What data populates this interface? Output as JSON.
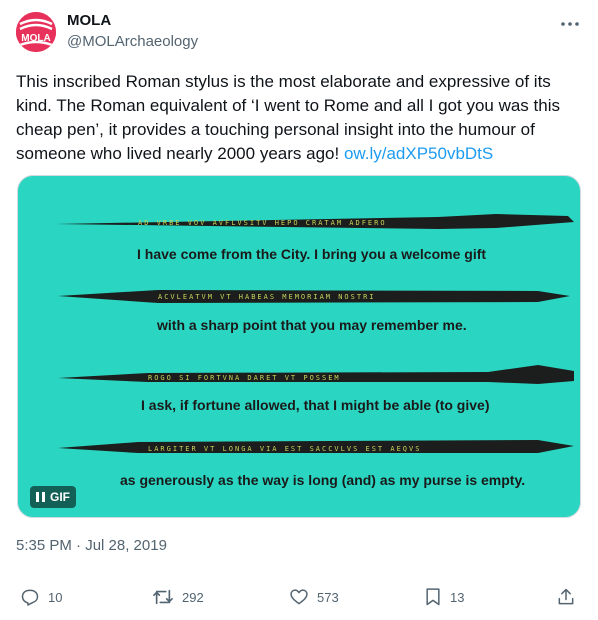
{
  "author": {
    "name": "MOLA",
    "handle": "@MOLArchaeology",
    "avatar_text": "MOLA"
  },
  "tweet": {
    "text_part1": "This inscribed Roman stylus is the most elaborate and expressive of its kind. The Roman equivalent of ‘I went to Rome and all I got you was this cheap pen’, it provides a touching personal insight into the humour of someone who lived nearly 2000 years ago! ",
    "link": "ow.ly/adXP50vbDtS"
  },
  "media": {
    "captions": [
      "I have come from the City. I bring you a welcome gift",
      "with a sharp point that you may remember me.",
      "I ask, if fortune allowed, that I might be able (to give)",
      "as generously as the way is long (and) as my purse is empty."
    ],
    "gif_label": "GIF",
    "background_color": "#2ad6c2"
  },
  "timestamp": "5:35 PM · Jul 28, 2019",
  "actions": {
    "replies": "10",
    "retweets": "292",
    "likes": "573",
    "bookmarks": "13"
  },
  "icons": {
    "more": "more-dots-icon",
    "reply": "reply-icon",
    "retweet": "retweet-icon",
    "like": "heart-icon",
    "bookmark": "bookmark-icon",
    "share": "share-icon",
    "pause": "pause-icon"
  }
}
